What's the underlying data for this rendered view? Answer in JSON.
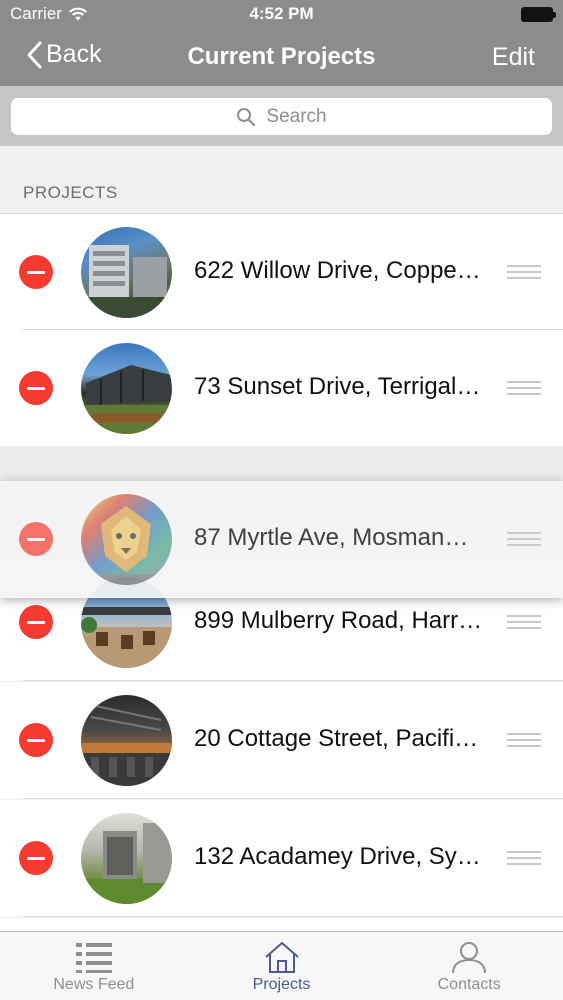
{
  "status_bar": {
    "carrier": "Carrier",
    "time": "4:52 PM"
  },
  "nav": {
    "back_label": "Back",
    "title": "Current Projects",
    "edit_label": "Edit"
  },
  "search": {
    "placeholder": "Search"
  },
  "section": {
    "header": "PROJECTS"
  },
  "projects": [
    {
      "label": "622 Willow Drive, Coppe…"
    },
    {
      "label": "73 Sunset Drive, Terrigal…"
    },
    {
      "label": "87 Myrtle Ave, Mosman…"
    },
    {
      "label": "899 Mulberry Road, Harr…"
    },
    {
      "label": "20 Cottage Street, Pacifi…"
    },
    {
      "label": "132 Acadamey Drive, Sy…"
    }
  ],
  "tabs": [
    {
      "label": "News Feed",
      "icon": "list-icon"
    },
    {
      "label": "Projects",
      "icon": "home-icon"
    },
    {
      "label": "Contacts",
      "icon": "person-icon"
    }
  ],
  "colors": {
    "nav_bg": "#8c8c8e",
    "delete_red": "#f53b30",
    "tab_active": "#4a5c8f"
  }
}
